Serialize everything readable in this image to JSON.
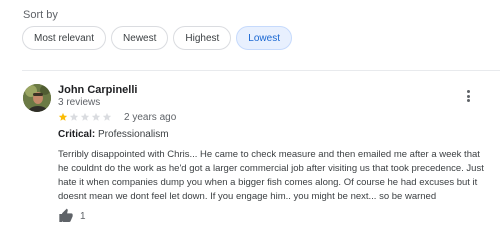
{
  "sort": {
    "label": "Sort by",
    "options": [
      "Most relevant",
      "Newest",
      "Highest",
      "Lowest"
    ],
    "selected": "Lowest"
  },
  "review": {
    "author": "John Carpinelli",
    "reviews_count": "3 reviews",
    "rating": 1,
    "rating_max": 5,
    "date": "2 years ago",
    "critical_label": "Critical:",
    "critical_value": "Professionalism",
    "text": "Terribly disappointed with Chris... He came to check measure and then emailed me after a week that he couldnt do the work as he'd got a larger commercial job after visiting us that took precedence. Just hate it when companies dump you when a bigger fish comes along. Of course he had excuses but it doesnt mean we dont feel let down. If you engage him.. you might be next... so be warned",
    "likes": "1"
  },
  "colors": {
    "star_filled": "#fbbc04",
    "star_empty": "#dadce0",
    "selected_chip_bg": "#e8f0fe",
    "selected_chip_text": "#1967d2"
  },
  "icons": {
    "more": "more-vert-icon",
    "like": "thumb-up-icon"
  }
}
